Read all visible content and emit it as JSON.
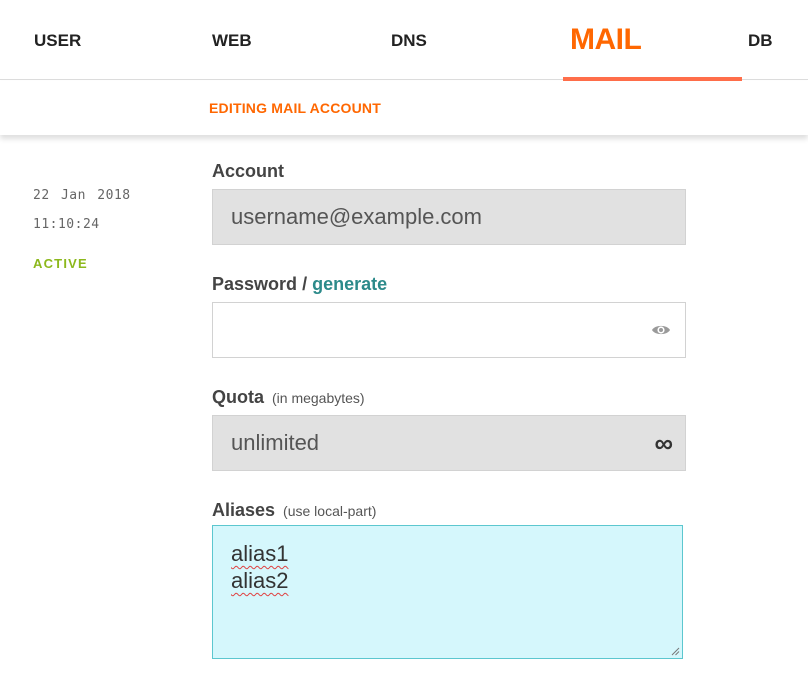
{
  "nav": {
    "user": "USER",
    "web": "WEB",
    "dns": "DNS",
    "mail": "MAIL",
    "db": "DB",
    "active_color": "#ff6701"
  },
  "subheader": {
    "title": "EDITING MAIL ACCOUNT"
  },
  "meta": {
    "date": "22 Jan 2018",
    "time": "11:10:24",
    "status": "ACTIVE",
    "status_color": "#8cb81c"
  },
  "form": {
    "account": {
      "label": "Account",
      "value": "username@example.com"
    },
    "password": {
      "label": "Password",
      "separator": "/",
      "generate_link": "generate",
      "value": "",
      "icon": "eye-icon"
    },
    "quota": {
      "label": "Quota",
      "hint": "(in megabytes)",
      "value": "unlimited",
      "icon": "infinity-icon",
      "icon_glyph": "∞"
    },
    "aliases": {
      "label": "Aliases",
      "hint": "(use local-part)",
      "lines": [
        "alias1",
        "alias2"
      ]
    }
  }
}
